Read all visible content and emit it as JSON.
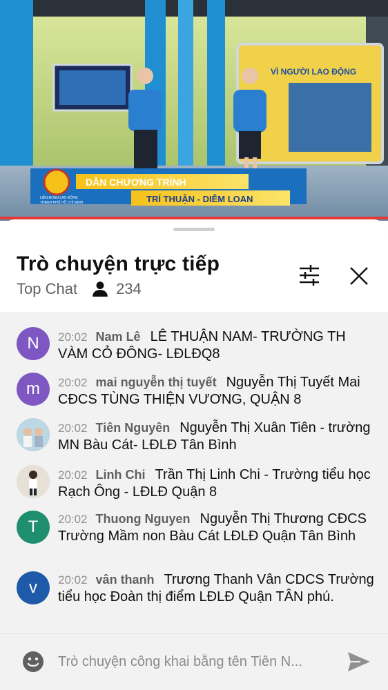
{
  "video": {
    "banner_title": "DẪN CHƯƠNG TRÌNH",
    "banner_names": "TRÍ THUẬN - DIỄM LOAN",
    "screen_heading": "VÌ NGƯỜI LAO ĐỘNG",
    "logo_caption_1": "LIÊN ĐOÀN LAO ĐỘNG",
    "logo_caption_2": "THÀNH PHỐ HỒ CHÍ MINH",
    "progress": 1.0
  },
  "chat": {
    "title": "Trò chuyện trực tiếp",
    "mode": "Top Chat",
    "viewer_count": "234",
    "icons": {
      "filter": "tune-icon",
      "close": "close-icon",
      "viewers": "person-icon"
    }
  },
  "messages": [
    {
      "time": "20:02",
      "author": "Nam Lê",
      "text": "LÊ THUẬN NAM- TRƯỜNG TH VÀM CỎ ĐÔNG- LĐLĐQ8",
      "initial": "N",
      "color": "#7e57c2"
    },
    {
      "time": "20:02",
      "author": "mai nguyễn thị tuyết",
      "text": "Nguyễn Thị Tuyết Mai CĐCS TÙNG THIỆN VƯƠNG, QUẬN 8",
      "initial": "m",
      "color": "#7e57c2"
    },
    {
      "time": "20:02",
      "author": "Tiên Nguyên",
      "text": "Nguyễn Thị Xuân Tiên - trường MN Bàu Cát- LĐLĐ Tân Bình",
      "initial": "",
      "color": "#9ec7d9"
    },
    {
      "time": "20:02",
      "author": "Linh Chi",
      "text": "Trần Thị Linh Chi - Trường tiểu học Rạch Ông - LĐLĐ Quận 8",
      "initial": "",
      "color": "#d9d2c8"
    },
    {
      "time": "20:02",
      "author": "Thuong Nguyen",
      "text": "Nguyễn Thị Thương CĐCS Trường Mầm non Bàu Cát LĐLĐ Quận Tân Bình",
      "initial": "T",
      "color": "#1e8e6e"
    },
    {
      "time": "20:02",
      "author": "vân thanh",
      "text": "Trương Thanh Vân CDCS Trường tiểu học Đoàn thị điểm LĐLĐ Quận TÂN phú.",
      "initial": "v",
      "color": "#1e5aa8"
    }
  ],
  "composer": {
    "placeholder": "Trò chuyện công khai bằng tên Tiên N...",
    "icons": {
      "emoji": "emoji-icon",
      "send": "send-icon"
    }
  }
}
